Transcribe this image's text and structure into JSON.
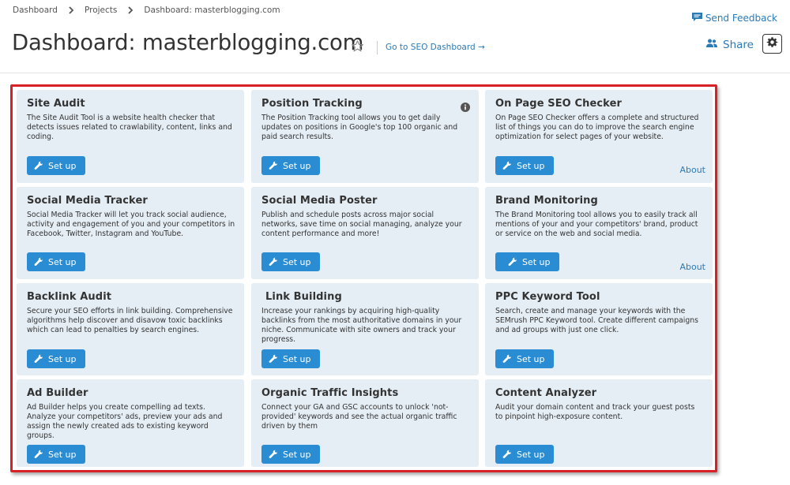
{
  "breadcrumb": {
    "items": [
      "Dashboard",
      "Projects",
      "Dashboard: masterblogging.com"
    ]
  },
  "header": {
    "title": "Dashboard: masterblogging.com",
    "seo_link": "Go to SEO Dashboard →",
    "feedback": "Send Feedback",
    "share": "Share"
  },
  "colors": {
    "accent": "#2a8dd4",
    "link": "#2a7ab6",
    "card_bg": "#e5eef5",
    "highlight_border": "#d92026"
  },
  "cards": [
    {
      "title": "Site Audit",
      "desc": "The Site Audit Tool is a website health checker that detects issues related to crawlability, content, links and coding.",
      "button": "Set up"
    },
    {
      "title": "Position Tracking",
      "desc": "The Position Tracking tool allows you to get daily updates on positions in Google's top 100 organic and paid search results.",
      "button": "Set up",
      "icon": "info-icon"
    },
    {
      "title": "On Page SEO Checker",
      "desc": "On Page SEO Checker offers a complete and structured list of things you can do to improve the search engine optimization for select pages of your website.",
      "button": "Set up",
      "about": "About"
    },
    {
      "title": "Social Media Tracker",
      "desc": "Social Media Tracker will let you track social audience, activity and engagement of you and your competitors in Facebook, Twitter, Instagram and YouTube.",
      "button": "Set up"
    },
    {
      "title": "Social Media Poster",
      "desc": "Publish and schedule posts across major social networks, save time on social managing, analyze your content performance and more!",
      "button": "Set up"
    },
    {
      "title": "Brand Monitoring",
      "desc": "The Brand Monitoring tool allows you to easily track all mentions of your and your competitors' brand, product or service on the web and social media.",
      "button": "Set up",
      "about": "About"
    },
    {
      "title": "Backlink Audit",
      "desc": "Secure your SEO efforts in link building. Comprehensive algorithms help discover and disavow toxic backlinks which can lead to penalties by search engines.",
      "button": "Set up"
    },
    {
      "title": "Link Building",
      "desc": "Increase your rankings by acquiring high-quality backlinks from the most authoritative domains in your niche. Communicate with site owners and track your progress.",
      "button": "Set up"
    },
    {
      "title": "PPC Keyword Tool",
      "desc": "Search, create and manage your keywords with the SEMrush PPC Keyword tool. Create different campaigns and ad groups with just one click.",
      "button": "Set up"
    },
    {
      "title": "Ad Builder",
      "desc": "Ad Builder helps you create compelling ad texts. Analyze your competitors' ads, preview your ads and assign the newly created ads to existing keyword groups.",
      "button": "Set up"
    },
    {
      "title": "Organic Traffic Insights",
      "desc": "Connect your GA and GSC accounts to unlock 'not-provided' keywords and see the actual organic traffic driven by them",
      "button": "Set up"
    },
    {
      "title": "Content Analyzer",
      "desc": "Audit your domain content and track your guest posts to pinpoint high-exposure content.",
      "button": "Set up"
    }
  ]
}
